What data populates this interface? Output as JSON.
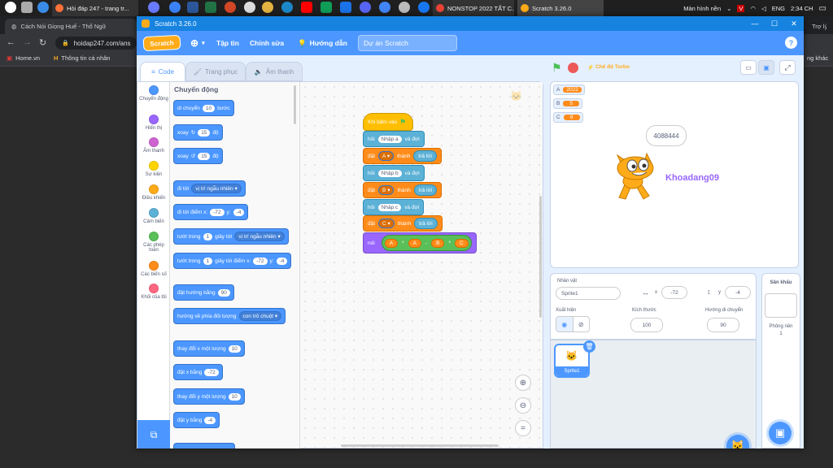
{
  "taskbar": {
    "tabs": [
      {
        "label": "Hỏi đáp 247 - trang tr..."
      },
      {
        "label": "NONSTOP 2022 TẤT C..."
      },
      {
        "label": "Scratch 3.26.0"
      }
    ],
    "tray": {
      "desktop": "Màn hình nền",
      "lang": "ENG",
      "time": "2:34 CH"
    }
  },
  "browser": {
    "tab_label": "Cách Nói Giọng Huế - Thổ Ngữ",
    "tab2_label": "Trợ lý kh",
    "url": "hoidap247.com/ans",
    "bookmarks": [
      {
        "label": "Home.vn"
      },
      {
        "label": "Thông tin cá nhân"
      }
    ],
    "bookmarks_right": "ng khác"
  },
  "window": {
    "title": "Scratch 3.26.0",
    "colors": {
      "accent": "#4c97ff",
      "titlebar": "#1683e0"
    }
  },
  "menu": {
    "logo": "Scratch",
    "file": "Tập tin",
    "edit": "Chỉnh sửa",
    "tutorials": "Hướng dẫn",
    "project_title": "Dự án Scratch",
    "help_icon": "?"
  },
  "editor_tabs": {
    "code": "Code",
    "costumes": "Trang phục",
    "sounds": "Âm thanh"
  },
  "categories": [
    {
      "label": "Chuyển động",
      "color": "#4c97ff"
    },
    {
      "label": "Hiển thị",
      "color": "#9966ff"
    },
    {
      "label": "Âm thanh",
      "color": "#cf63cf"
    },
    {
      "label": "Sự kiện",
      "color": "#ffd500"
    },
    {
      "label": "Điều khiển",
      "color": "#ffab19"
    },
    {
      "label": "Cảm biến",
      "color": "#5cb1d6"
    },
    {
      "label": "Các phép toán",
      "color": "#59c059"
    },
    {
      "label": "Các biến số",
      "color": "#ff8c1a"
    },
    {
      "label": "Khối của tôi",
      "color": "#ff6680"
    }
  ],
  "palette": {
    "title": "Chuyển động",
    "move": {
      "a": "di chuyển",
      "v": "10",
      "b": "bước"
    },
    "turn_right": {
      "a": "xoay",
      "v": "15",
      "b": "độ"
    },
    "turn_left": {
      "a": "xoay",
      "v": "15",
      "b": "độ"
    },
    "goto": {
      "a": "đi tới",
      "dd": "vị trí ngẫu nhiên"
    },
    "goto_xy": {
      "a": "đi tới điểm x:",
      "x": "-72",
      "b": "y:",
      "y": "-4"
    },
    "glide": {
      "a": "lướt trong",
      "v": "1",
      "b": "giây tới",
      "dd": "vị trí ngẫu nhiên"
    },
    "glide_xy": {
      "a": "lướt trong",
      "v": "1",
      "b": "giây tới điểm x:",
      "x": "-72",
      "c": "y:",
      "y": "-4"
    },
    "point_dir": {
      "a": "đặt hướng bằng",
      "v": "90"
    },
    "point_towards": {
      "a": "hướng về phía đối tượng",
      "dd": "con trỏ chuột"
    },
    "change_x": {
      "a": "thay đổi x một lượng",
      "v": "10"
    },
    "set_x": {
      "a": "đặt x bằng",
      "v": "-72"
    },
    "change_y": {
      "a": "thay đổi y một lượng",
      "v": "10"
    },
    "set_y": {
      "a": "đặt y bằng",
      "v": "-4"
    }
  },
  "script": {
    "hat": "Khi bấm vào",
    "ask1": {
      "a": "hỏi",
      "v": "Nhập a",
      "b": "và đợi"
    },
    "set1": {
      "a": "đặt",
      "var": "A",
      "b": "thành",
      "v": "trả lời"
    },
    "ask2": {
      "a": "hỏi",
      "v": "Nhập b",
      "b": "và đợi"
    },
    "set2": {
      "a": "đặt",
      "var": "B",
      "b": "thành",
      "v": "trả lời"
    },
    "ask3": {
      "a": "hỏi",
      "v": "Nhập c",
      "b": "và đợi"
    },
    "set3": {
      "a": "đặt",
      "var": "C",
      "b": "thành",
      "v": "trả lời"
    },
    "say": {
      "a": "nói",
      "e1": "A",
      "op1": "*",
      "e2": "A",
      "op2": "-",
      "e3": "B",
      "op3": "*",
      "e4": "C"
    }
  },
  "stage_header": {
    "turbo": "Chế độ Turbo"
  },
  "monitors": [
    {
      "name": "A",
      "value": "2022"
    },
    {
      "name": "B",
      "value": "5"
    },
    {
      "name": "C",
      "value": "8"
    }
  ],
  "stage": {
    "bubble": "4088444",
    "sprite_label": "Khoadang09"
  },
  "sprite_info": {
    "label_sprite": "Nhân vật",
    "sprite_name": "Sprite1",
    "x_label": "x",
    "x": "-72",
    "y_label": "y",
    "y": "-4",
    "label_show": "Xuất hiện",
    "label_size": "Kích thước",
    "size": "100",
    "label_dir": "Hướng di chuyển",
    "direction": "90"
  },
  "sprite_list": [
    {
      "name": "Sprite1"
    }
  ],
  "stage_panel": {
    "title": "Sân khấu",
    "backdrops_label": "Phông nền",
    "backdrops_count": "1"
  }
}
